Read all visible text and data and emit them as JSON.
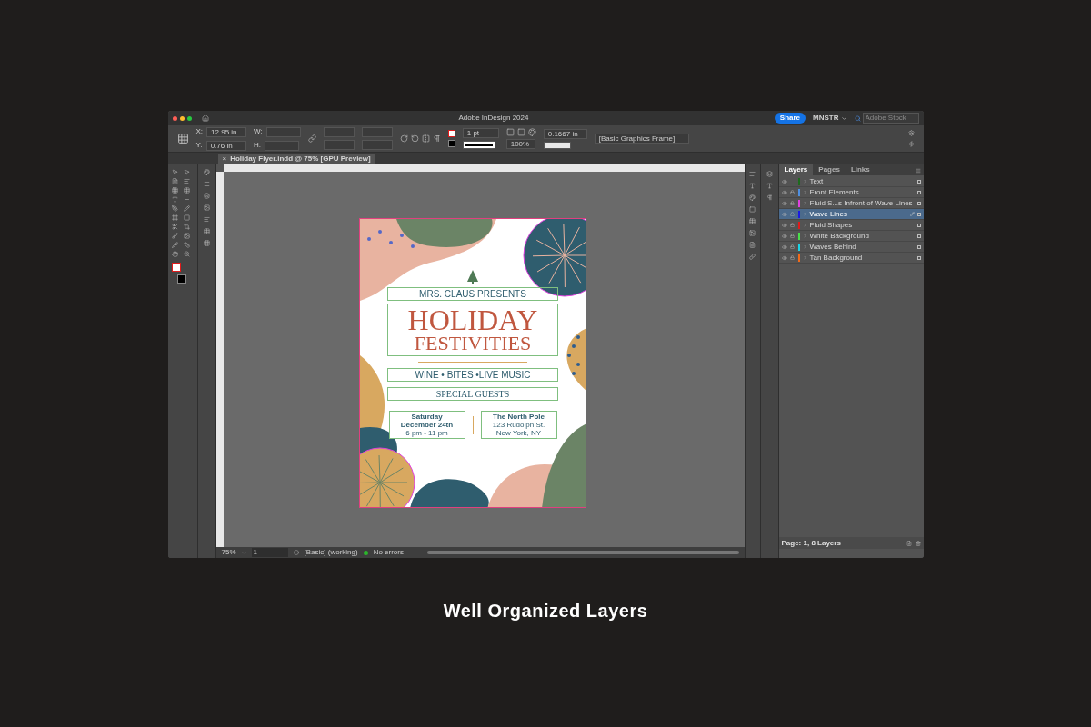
{
  "window": {
    "title": "Adobe InDesign 2024"
  },
  "header": {
    "share": "Share",
    "account": "MNSTR",
    "search_placeholder": "Adobe Stock"
  },
  "control_bar": {
    "x_label": "X:",
    "x_value": "12.95 in",
    "y_label": "Y:",
    "y_value": "0.76 in",
    "w_label": "W:",
    "h_label": "H:",
    "stroke_weight": "1 pt",
    "scale": "100%",
    "offset": "0.1667 in",
    "object_style": "[Basic Graphics Frame]"
  },
  "document_tab": {
    "close": "×",
    "title": "Holiday Flyer.indd @ 75% [GPU Preview]"
  },
  "flyer": {
    "eyebrow": "MRS. CLAUS PRESENTS",
    "title_1": "HOLIDAY",
    "title_2": "FESTIVITIES",
    "tagline": "WINE • BITES •LIVE MUSIC",
    "subhead": "SPECIAL GUESTS",
    "date_title": "Saturday",
    "date": "December 24th",
    "time": "6 pm - 11 pm",
    "venue": "The North Pole",
    "address_1": "123 Rudolph St.",
    "address_2": "New York, NY"
  },
  "panel_tabs": [
    {
      "label": "Layers",
      "selected": true
    },
    {
      "label": "Pages",
      "selected": false
    },
    {
      "label": "Links",
      "selected": false
    }
  ],
  "layers": [
    {
      "name": "Text",
      "color": "#1e6b1e",
      "locked": false,
      "selected": false
    },
    {
      "name": "Front Elements",
      "color": "#4f8fe0",
      "locked": true,
      "selected": false
    },
    {
      "name": "Fluid S...s Infront of Wave Lines",
      "color": "#e040e0",
      "locked": true,
      "selected": false
    },
    {
      "name": "Wave Lines",
      "color": "#1a1ae6",
      "locked": true,
      "selected": true
    },
    {
      "name": "Fluid Shapes",
      "color": "#e01a1a",
      "locked": true,
      "selected": false
    },
    {
      "name": "White Background",
      "color": "#4ade4a",
      "locked": true,
      "selected": false
    },
    {
      "name": "Waves Behind",
      "color": "#1ad4e6",
      "locked": true,
      "selected": false
    },
    {
      "name": "Tan Background",
      "color": "#f06a1a",
      "locked": true,
      "selected": false
    }
  ],
  "layers_footer": "Page: 1, 8 Layers",
  "status_bar": {
    "zoom": "75%",
    "page": "1",
    "preflight_profile": "[Basic] (working)",
    "errors": "No errors"
  },
  "caption": "Well Organized Layers"
}
